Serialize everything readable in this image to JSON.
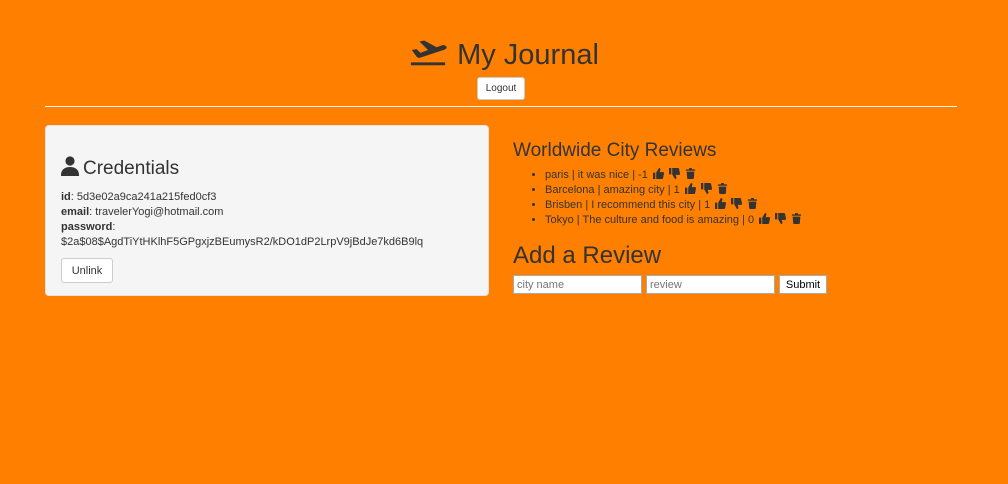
{
  "header": {
    "title": "My Journal",
    "logout_label": "Logout"
  },
  "credentials": {
    "heading": "Credentials",
    "id_label": "id",
    "id_value": "5d3e02a9ca241a215fed0cf3",
    "email_label": "email",
    "email_value": "travelerYogi@hotmail.com",
    "password_label": "password",
    "password_value": "$2a$08$AgdTiYtHKlhF5GPgxjzBEumysR2/kDO1dP2LrpV9jBdJe7kd6B9lq",
    "unlink_label": "Unlink"
  },
  "reviews": {
    "heading": "Worldwide City Reviews",
    "items": [
      {
        "text": "paris | it was nice | -1"
      },
      {
        "text": "Barcelona | amazing city | 1"
      },
      {
        "text": "Brisben | I recommend this city | 1"
      },
      {
        "text": "Tokyo | The culture and food is amazing | 0"
      }
    ]
  },
  "add_review": {
    "heading": "Add a Review",
    "city_placeholder": "city name",
    "review_placeholder": "review",
    "submit_label": "Submit"
  },
  "colors": {
    "background": "#ff8000",
    "text": "#333333",
    "card": "#f5f5f5"
  },
  "icons": {
    "title": "plane-departure-icon",
    "credentials": "user-icon",
    "review_actions": [
      "thumbs-up-icon",
      "thumbs-down-icon",
      "trash-icon"
    ]
  }
}
